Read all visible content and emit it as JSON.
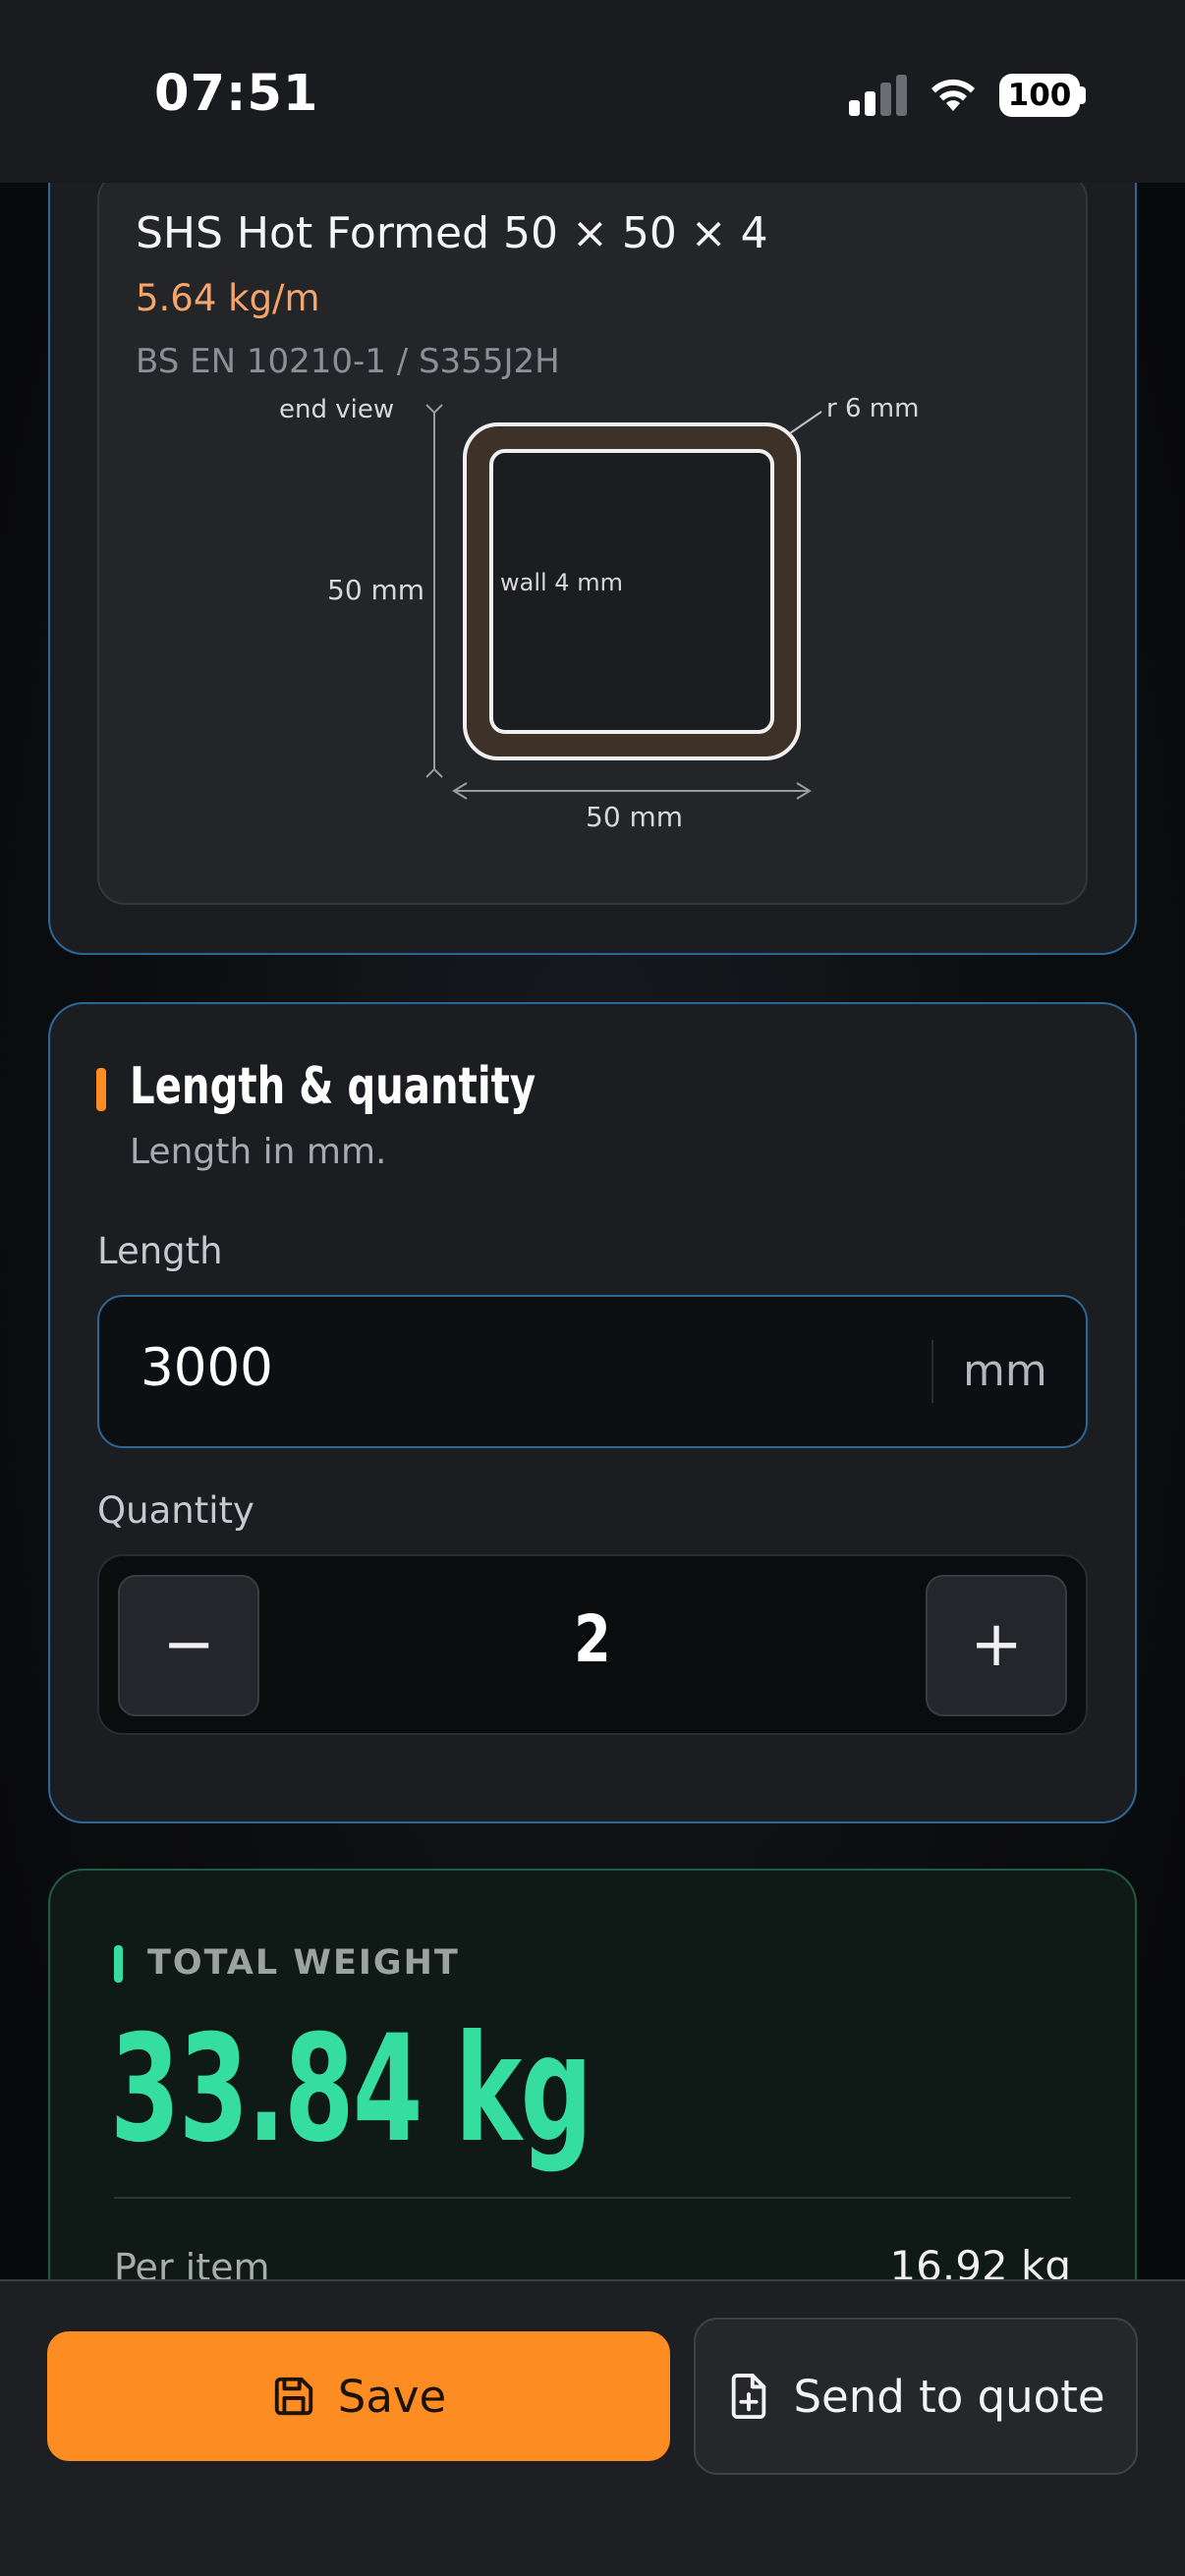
{
  "status_bar": {
    "time": "07:51",
    "battery": "100"
  },
  "profile_card": {
    "title": "SHS Hot Formed 50 × 50 × 4",
    "weight_per_meter": "5.64 kg/m",
    "standard": "BS EN 10210-1 / S355J2H",
    "diagram": {
      "view_label": "end view",
      "height_label": "50 mm",
      "width_label": "50 mm",
      "radius_label": "r 6 mm",
      "wall_label": "wall 4 mm"
    }
  },
  "length_card": {
    "title": "Length & quantity",
    "subtitle": "Length in mm.",
    "length_label": "Length",
    "length_value": "3000",
    "length_unit": "mm",
    "quantity_label": "Quantity",
    "quantity_value": "2",
    "decrement_label": "−",
    "increment_label": "+"
  },
  "total_card": {
    "label": "TOTAL WEIGHT",
    "value": "33.84 kg",
    "per_item_label": "Per item",
    "per_item_value": "16.92 kg"
  },
  "actions": {
    "save_label": "Save",
    "quote_label": "Send to quote"
  },
  "colors": {
    "accent_orange": "#fd8c23",
    "accent_green": "#35dea0",
    "card_border_blue": "#2c6897",
    "weight_text": "#f6a56a"
  },
  "icons": {
    "save": "floppy-disk-icon",
    "quote": "file-plus-icon"
  }
}
